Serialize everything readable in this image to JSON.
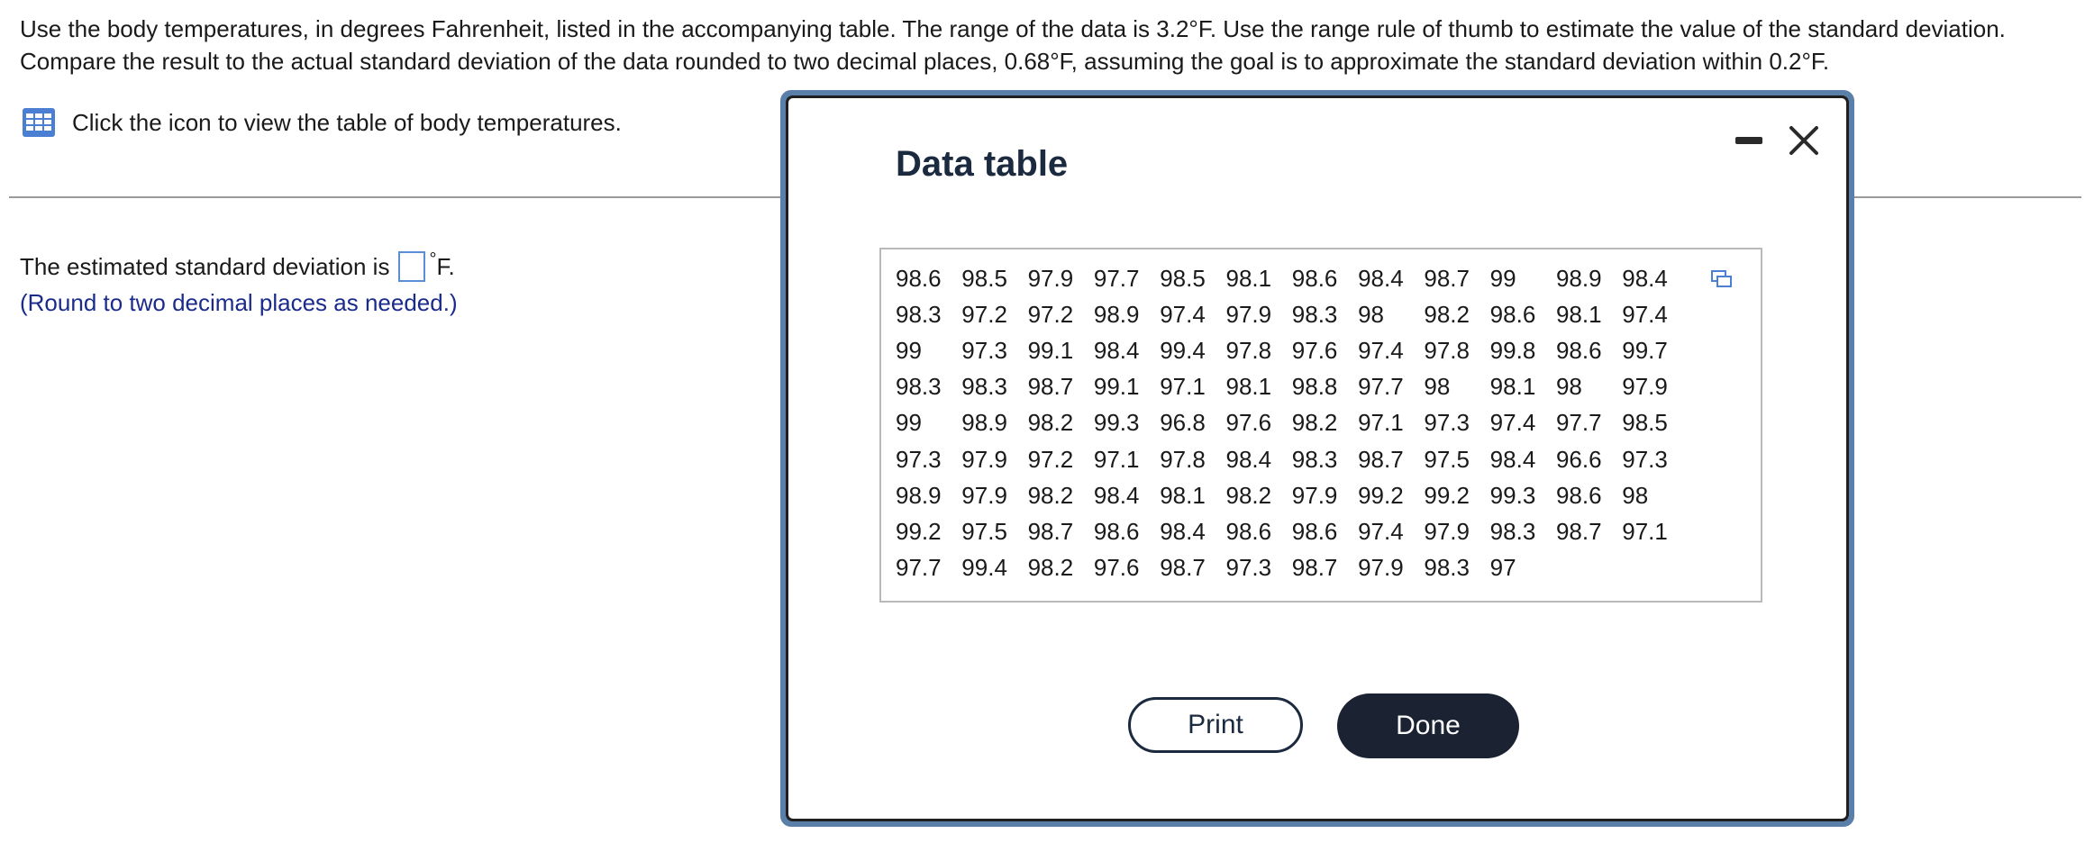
{
  "question": {
    "line1": "Use the body temperatures, in degrees Fahrenheit, listed in the accompanying table. The range of the data is 3.2°F. Use the range rule of thumb to estimate the value of the standard deviation.",
    "line2": "Compare the result to the actual standard deviation of the data rounded to two decimal places, 0.68°F, assuming the goal is to approximate the standard deviation within 0.2°F."
  },
  "table_link": {
    "icon": "table-grid-icon",
    "label": "Click the icon to view the table of body temperatures."
  },
  "answer": {
    "prefix": "The estimated standard deviation is",
    "value": "",
    "degree": "°",
    "unit": "F.",
    "hint": "(Round to two decimal places as needed.)"
  },
  "modal": {
    "title": "Data table",
    "minimize_icon": "minimize-icon",
    "close_icon": "close-icon",
    "copy_icon": "copy-icon",
    "rows": [
      [
        "98.6",
        "98.5",
        "97.9",
        "97.7",
        "98.5",
        "98.1",
        "98.6",
        "98.4",
        "98.7",
        "99",
        "98.9",
        "98.4"
      ],
      [
        "98.3",
        "97.2",
        "97.2",
        "98.9",
        "97.4",
        "97.9",
        "98.3",
        "98",
        "98.2",
        "98.6",
        "98.1",
        "97.4"
      ],
      [
        "99",
        "97.3",
        "99.1",
        "98.4",
        "99.4",
        "97.8",
        "97.6",
        "97.4",
        "97.8",
        "99.8",
        "98.6",
        "99.7"
      ],
      [
        "98.3",
        "98.3",
        "98.7",
        "99.1",
        "97.1",
        "98.1",
        "98.8",
        "97.7",
        "98",
        "98.1",
        "98",
        "97.9"
      ],
      [
        "99",
        "98.9",
        "98.2",
        "99.3",
        "96.8",
        "97.6",
        "98.2",
        "97.1",
        "97.3",
        "97.4",
        "97.7",
        "98.5"
      ],
      [
        "97.3",
        "97.9",
        "97.2",
        "97.1",
        "97.8",
        "98.4",
        "98.3",
        "98.7",
        "97.5",
        "98.4",
        "96.6",
        "97.3"
      ],
      [
        "98.9",
        "97.9",
        "98.2",
        "98.4",
        "98.1",
        "98.2",
        "97.9",
        "99.2",
        "99.2",
        "99.3",
        "98.6",
        "98"
      ],
      [
        "99.2",
        "97.5",
        "98.7",
        "98.6",
        "98.4",
        "98.6",
        "98.6",
        "97.4",
        "97.9",
        "98.3",
        "98.7",
        "97.1"
      ],
      [
        "97.7",
        "99.4",
        "98.2",
        "97.6",
        "98.7",
        "97.3",
        "98.7",
        "97.9",
        "98.3",
        "97"
      ]
    ],
    "print_label": "Print",
    "done_label": "Done"
  },
  "colors": {
    "accent": "#5b8dd9",
    "hint_text": "#1a2b8c",
    "modal_border": "#5a7fa8",
    "done_bg": "#1b2332"
  }
}
